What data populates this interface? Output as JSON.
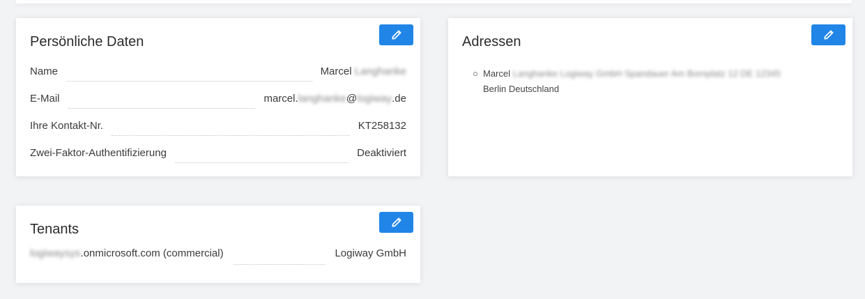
{
  "personal": {
    "title": "Persönliche Daten",
    "edit_icon": "pencil-icon",
    "rows": [
      {
        "label": "Name",
        "value_visible": "Marcel",
        "value_redacted": "Langhanke"
      },
      {
        "label": "E-Mail",
        "value_prefix": "marcel.",
        "value_redacted_1": "langhanke",
        "value_at": "@",
        "value_redacted_2": "logiway",
        "value_suffix": ".de"
      },
      {
        "label": "Ihre Kontakt-Nr.",
        "value": "KT258132"
      },
      {
        "label": "Zwei-Faktor-Authentifizierung",
        "value": "Deaktiviert"
      }
    ]
  },
  "address": {
    "title": "Adressen",
    "edit_icon": "pencil-icon",
    "items": [
      {
        "line1_visible": "Marcel",
        "line1_redacted": "Langhanke Logiway GmbH Spandauer Am Bornplatz 12 DE 12345",
        "line2": "Berlin Deutschland"
      }
    ]
  },
  "tenants": {
    "title": "Tenants",
    "edit_icon": "pencil-icon",
    "rows": [
      {
        "label_redacted": "logiwaysys",
        "label_visible": ".onmicrosoft.com (commercial)",
        "value": "Logiway GmbH"
      }
    ]
  },
  "colors": {
    "button": "#2185e8",
    "background": "#f2f3f5",
    "card": "#ffffff"
  }
}
